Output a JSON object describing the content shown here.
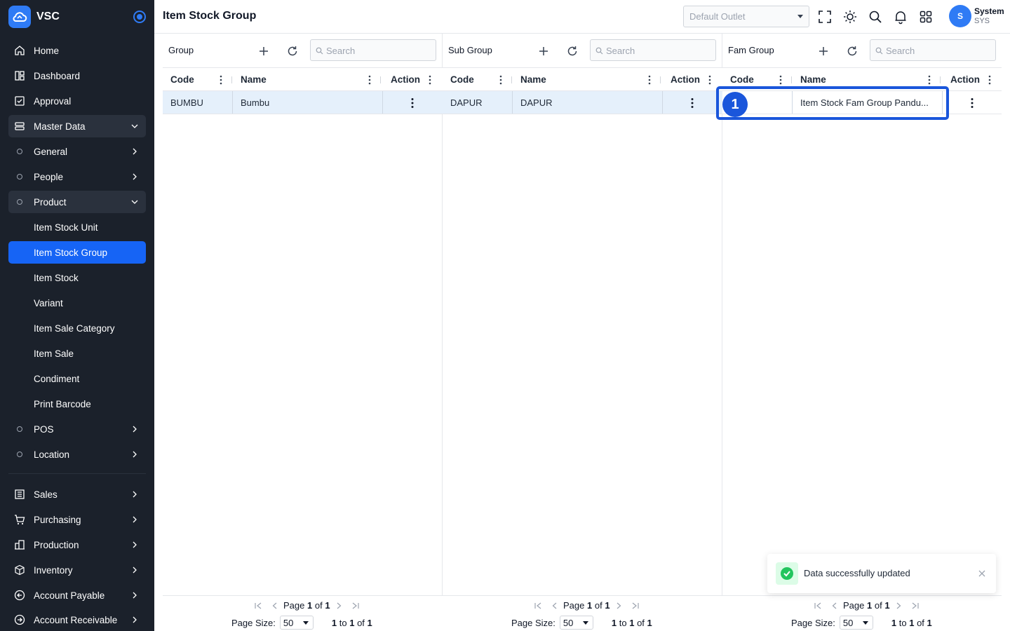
{
  "app": {
    "name": "VSC"
  },
  "header": {
    "title": "Item Stock Group",
    "outlet_placeholder": "Default Outlet",
    "user": {
      "initial": "S",
      "name": "System",
      "code": "SYS"
    }
  },
  "sidebar": {
    "home": "Home",
    "dashboard": "Dashboard",
    "approval": "Approval",
    "master_data": "Master Data",
    "general": "General",
    "people": "People",
    "product": "Product",
    "product_items": [
      "Item Stock Unit",
      "Item Stock Group",
      "Item Stock",
      "Variant",
      "Item Sale Category",
      "Item Sale",
      "Condiment",
      "Print Barcode"
    ],
    "pos": "POS",
    "location": "Location",
    "sales": "Sales",
    "purchasing": "Purchasing",
    "production": "Production",
    "inventory": "Inventory",
    "account_payable": "Account Payable",
    "account_receivable": "Account Receivable"
  },
  "panels": [
    {
      "title": "Group",
      "search_placeholder": "Search",
      "columns": {
        "code": "Code",
        "name": "Name",
        "action": "Action"
      },
      "rows": [
        {
          "code": "BUMBU",
          "name": "Bumbu"
        }
      ],
      "footer": {
        "page": "Page",
        "current": "1",
        "of": "of",
        "total": "1",
        "page_size_label": "Page Size:",
        "page_size": "50",
        "range_from": "1",
        "to": "to",
        "range_to": "1",
        "of2": "of",
        "count": "1"
      }
    },
    {
      "title": "Sub Group",
      "search_placeholder": "Search",
      "columns": {
        "code": "Code",
        "name": "Name",
        "action": "Action"
      },
      "rows": [
        {
          "code": "DAPUR",
          "name": "DAPUR"
        }
      ],
      "footer": {
        "page": "Page",
        "current": "1",
        "of": "of",
        "total": "1",
        "page_size_label": "Page Size:",
        "page_size": "50",
        "range_from": "1",
        "to": "to",
        "range_to": "1",
        "of2": "of",
        "count": "1"
      }
    },
    {
      "title": "Fam Group",
      "search_placeholder": "Search",
      "columns": {
        "code": "Code",
        "name": "Name",
        "action": "Action"
      },
      "rows": [
        {
          "code": "",
          "name": "Item Stock Fam Group Pandu..."
        }
      ],
      "footer": {
        "page": "Page",
        "current": "1",
        "of": "of",
        "total": "1",
        "page_size_label": "Page Size:",
        "page_size": "50",
        "range_from": "1",
        "to": "to",
        "range_to": "1",
        "of2": "of",
        "count": "1"
      }
    }
  ],
  "annotation": {
    "step": "1"
  },
  "toast": {
    "message": "Data successfully updated"
  },
  "colors": {
    "sidebar_bg": "#1b212b",
    "accent": "#1664f5",
    "selected_row": "#e5f0fb",
    "success": "#22c55e",
    "annotation": "#1a56db"
  }
}
